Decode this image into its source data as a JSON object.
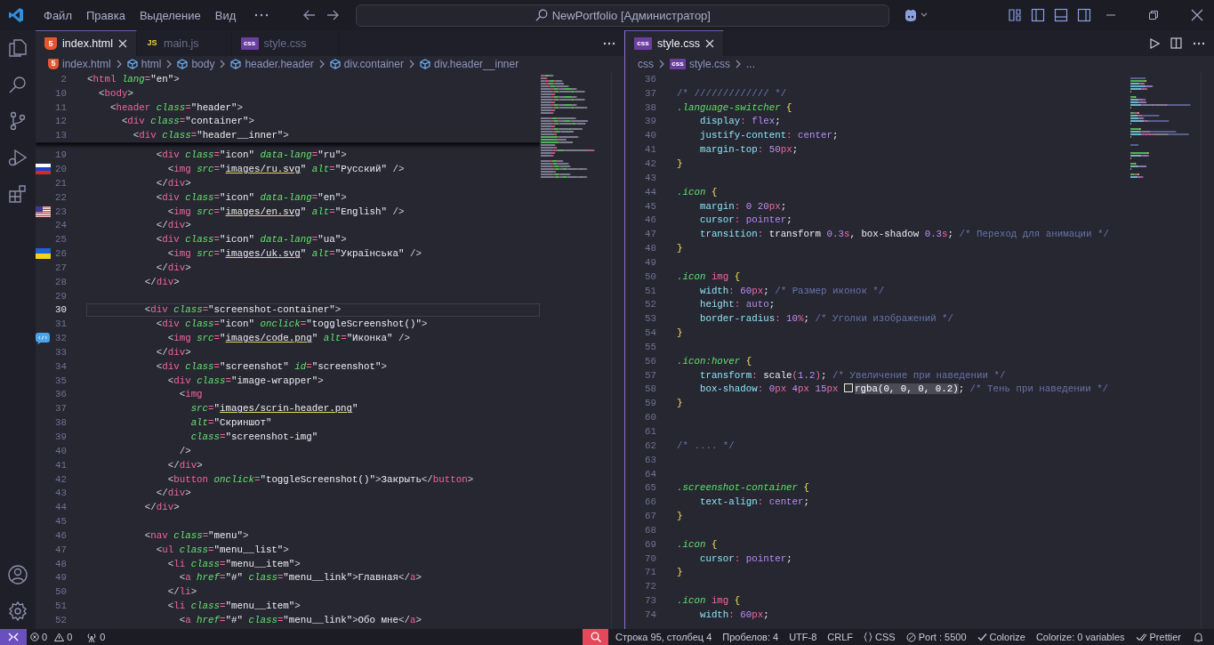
{
  "title_bar": {
    "menu": [
      "Файл",
      "Правка",
      "Выделение",
      "Вид"
    ],
    "search": {
      "text": "NewPortfolio [Администратор]"
    }
  },
  "editor_groups": [
    {
      "active": false,
      "tabs": [
        {
          "label": "index.html",
          "kind": "html",
          "badge": "5",
          "selected": true
        },
        {
          "label": "main.js",
          "kind": "js",
          "badge": "JS",
          "selected": false
        },
        {
          "label": "style.css",
          "kind": "css",
          "badge": "css",
          "selected": false
        }
      ],
      "breadcrumb": [
        {
          "label": "index.html",
          "kind": "html",
          "badge": "5"
        },
        {
          "label": "html",
          "kind": "element"
        },
        {
          "label": "body",
          "kind": "element"
        },
        {
          "label": "header.header",
          "kind": "element"
        },
        {
          "label": "div.container",
          "kind": "element"
        },
        {
          "label": "div.header__inner",
          "kind": "element"
        }
      ],
      "sticky_lines": [
        {
          "number": "2",
          "tokens": [
            {
              "kind": "p",
              "text": "<"
            },
            {
              "kind": "tag",
              "text": "html"
            },
            {
              "kind": "attr",
              "text": " lang"
            },
            {
              "kind": "op",
              "text": "="
            },
            {
              "kind": "str",
              "text": "\"en\""
            },
            {
              "kind": "p",
              "text": ">"
            }
          ]
        },
        {
          "number": "10",
          "tokens": [
            {
              "kind": "p",
              "text": "  <"
            },
            {
              "kind": "tag",
              "text": "body"
            },
            {
              "kind": "p",
              "text": ">"
            }
          ]
        },
        {
          "number": "11",
          "tokens": [
            {
              "kind": "p",
              "text": "    <"
            },
            {
              "kind": "tag",
              "text": "header"
            },
            {
              "kind": "attr",
              "text": " class"
            },
            {
              "kind": "op",
              "text": "="
            },
            {
              "kind": "str",
              "text": "\"header\""
            },
            {
              "kind": "p",
              "text": ">"
            }
          ]
        },
        {
          "number": "12",
          "tokens": [
            {
              "kind": "p",
              "text": "      <"
            },
            {
              "kind": "tag",
              "text": "div"
            },
            {
              "kind": "attr",
              "text": " class"
            },
            {
              "kind": "op",
              "text": "="
            },
            {
              "kind": "str",
              "text": "\"container\""
            },
            {
              "kind": "p",
              "text": ">"
            }
          ]
        },
        {
          "number": "13",
          "tokens": [
            {
              "kind": "p",
              "text": "        <"
            },
            {
              "kind": "tag",
              "text": "div"
            },
            {
              "kind": "attr",
              "text": " class"
            },
            {
              "kind": "op",
              "text": "="
            },
            {
              "kind": "str",
              "text": "\"header__inner\""
            },
            {
              "kind": "p",
              "text": ">"
            }
          ]
        }
      ],
      "lines": [
        {
          "number": "19",
          "current": false,
          "tokens": [
            {
              "kind": "p",
              "text": "            <"
            },
            {
              "kind": "tag",
              "text": "div"
            },
            {
              "kind": "attr",
              "text": " class"
            },
            {
              "kind": "op",
              "text": "="
            },
            {
              "kind": "str",
              "text": "\"icon\""
            },
            {
              "kind": "attr",
              "text": " data-lang"
            },
            {
              "kind": "op",
              "text": "="
            },
            {
              "kind": "str",
              "text": "\"ru\""
            },
            {
              "kind": "p",
              "text": ">"
            }
          ]
        },
        {
          "number": "20",
          "current": false,
          "gutter_icon": {
            "kind": "flag-ru"
          },
          "tokens": [
            {
              "kind": "p",
              "text": "              <"
            },
            {
              "kind": "tag",
              "text": "img"
            },
            {
              "kind": "attr",
              "text": " src"
            },
            {
              "kind": "op",
              "text": "="
            },
            {
              "kind": "str",
              "text": "\""
            },
            {
              "kind": "link",
              "text": "images/ru.svg"
            },
            {
              "kind": "str",
              "text": "\""
            },
            {
              "kind": "attr",
              "text": " alt"
            },
            {
              "kind": "op",
              "text": "="
            },
            {
              "kind": "str",
              "text": "\"Русский\""
            },
            {
              "kind": "p",
              "text": " />"
            }
          ]
        },
        {
          "number": "21",
          "current": false,
          "tokens": [
            {
              "kind": "p",
              "text": "            </"
            },
            {
              "kind": "tag",
              "text": "div"
            },
            {
              "kind": "p",
              "text": ">"
            }
          ]
        },
        {
          "number": "22",
          "current": false,
          "tokens": [
            {
              "kind": "p",
              "text": "            <"
            },
            {
              "kind": "tag",
              "text": "div"
            },
            {
              "kind": "attr",
              "text": " class"
            },
            {
              "kind": "op",
              "text": "="
            },
            {
              "kind": "str",
              "text": "\"icon\""
            },
            {
              "kind": "attr",
              "text": " data-lang"
            },
            {
              "kind": "op",
              "text": "="
            },
            {
              "kind": "str",
              "text": "\"en\""
            },
            {
              "kind": "p",
              "text": ">"
            }
          ]
        },
        {
          "number": "23",
          "current": false,
          "gutter_icon": {
            "kind": "flag-us"
          },
          "tokens": [
            {
              "kind": "p",
              "text": "              <"
            },
            {
              "kind": "tag",
              "text": "img"
            },
            {
              "kind": "attr",
              "text": " src"
            },
            {
              "kind": "op",
              "text": "="
            },
            {
              "kind": "str",
              "text": "\""
            },
            {
              "kind": "link",
              "text": "images/en.svg"
            },
            {
              "kind": "str",
              "text": "\""
            },
            {
              "kind": "attr",
              "text": " alt"
            },
            {
              "kind": "op",
              "text": "="
            },
            {
              "kind": "str",
              "text": "\"English\""
            },
            {
              "kind": "p",
              "text": " />"
            }
          ]
        },
        {
          "number": "24",
          "current": false,
          "tokens": [
            {
              "kind": "p",
              "text": "            </"
            },
            {
              "kind": "tag",
              "text": "div"
            },
            {
              "kind": "p",
              "text": ">"
            }
          ]
        },
        {
          "number": "25",
          "current": false,
          "tokens": [
            {
              "kind": "p",
              "text": "            <"
            },
            {
              "kind": "tag",
              "text": "div"
            },
            {
              "kind": "attr",
              "text": " class"
            },
            {
              "kind": "op",
              "text": "="
            },
            {
              "kind": "str",
              "text": "\"icon\""
            },
            {
              "kind": "attr",
              "text": " data-lang"
            },
            {
              "kind": "op",
              "text": "="
            },
            {
              "kind": "str",
              "text": "\"ua\""
            },
            {
              "kind": "p",
              "text": ">"
            }
          ]
        },
        {
          "number": "26",
          "current": false,
          "gutter_icon": {
            "kind": "flag-ua"
          },
          "tokens": [
            {
              "kind": "p",
              "text": "              <"
            },
            {
              "kind": "tag",
              "text": "img"
            },
            {
              "kind": "attr",
              "text": " src"
            },
            {
              "kind": "op",
              "text": "="
            },
            {
              "kind": "str",
              "text": "\""
            },
            {
              "kind": "link",
              "text": "images/uk.svg"
            },
            {
              "kind": "str",
              "text": "\""
            },
            {
              "kind": "attr",
              "text": " alt"
            },
            {
              "kind": "op",
              "text": "="
            },
            {
              "kind": "str",
              "text": "\"Українська\""
            },
            {
              "kind": "p",
              "text": " />"
            }
          ]
        },
        {
          "number": "27",
          "current": false,
          "tokens": [
            {
              "kind": "p",
              "text": "            </"
            },
            {
              "kind": "tag",
              "text": "div"
            },
            {
              "kind": "p",
              "text": ">"
            }
          ]
        },
        {
          "number": "28",
          "current": false,
          "tokens": [
            {
              "kind": "p",
              "text": "          </"
            },
            {
              "kind": "tag",
              "text": "div"
            },
            {
              "kind": "p",
              "text": ">"
            }
          ]
        },
        {
          "number": "29",
          "current": false
        },
        {
          "number": "30",
          "current": true,
          "tokens": [
            {
              "kind": "p",
              "text": "          <"
            },
            {
              "kind": "tag",
              "text": "div"
            },
            {
              "kind": "attr",
              "text": " class"
            },
            {
              "kind": "op",
              "text": "="
            },
            {
              "kind": "str",
              "text": "\"screenshot-container\""
            },
            {
              "kind": "p",
              "text": ">"
            }
          ]
        },
        {
          "number": "31",
          "current": false,
          "tokens": [
            {
              "kind": "p",
              "text": "            <"
            },
            {
              "kind": "tag",
              "text": "div"
            },
            {
              "kind": "attr",
              "text": " class"
            },
            {
              "kind": "op",
              "text": "="
            },
            {
              "kind": "str",
              "text": "\"icon\""
            },
            {
              "kind": "attr",
              "text": " onclick"
            },
            {
              "kind": "op",
              "text": "="
            },
            {
              "kind": "str",
              "text": "\"toggleScreenshot()\""
            },
            {
              "kind": "p",
              "text": ">"
            }
          ]
        },
        {
          "number": "32",
          "current": false,
          "gutter_icon": {
            "kind": "code-image"
          },
          "tokens": [
            {
              "kind": "p",
              "text": "              <"
            },
            {
              "kind": "tag",
              "text": "img"
            },
            {
              "kind": "attr",
              "text": " src"
            },
            {
              "kind": "op",
              "text": "="
            },
            {
              "kind": "str",
              "text": "\""
            },
            {
              "kind": "link",
              "text": "images/code.png"
            },
            {
              "kind": "str",
              "text": "\""
            },
            {
              "kind": "attr",
              "text": " alt"
            },
            {
              "kind": "op",
              "text": "="
            },
            {
              "kind": "str",
              "text": "\"Иконка\""
            },
            {
              "kind": "p",
              "text": " />"
            }
          ]
        },
        {
          "number": "33",
          "current": false,
          "tokens": [
            {
              "kind": "p",
              "text": "            </"
            },
            {
              "kind": "tag",
              "text": "div"
            },
            {
              "kind": "p",
              "text": ">"
            }
          ]
        },
        {
          "number": "34",
          "current": false,
          "tokens": [
            {
              "kind": "p",
              "text": "            <"
            },
            {
              "kind": "tag",
              "text": "div"
            },
            {
              "kind": "attr",
              "text": " class"
            },
            {
              "kind": "op",
              "text": "="
            },
            {
              "kind": "str",
              "text": "\"screenshot\""
            },
            {
              "kind": "attr",
              "text": " id"
            },
            {
              "kind": "op",
              "text": "="
            },
            {
              "kind": "str",
              "text": "\"screenshot\""
            },
            {
              "kind": "p",
              "text": ">"
            }
          ]
        },
        {
          "number": "35",
          "current": false,
          "tokens": [
            {
              "kind": "p",
              "text": "              <"
            },
            {
              "kind": "tag",
              "text": "div"
            },
            {
              "kind": "attr",
              "text": " class"
            },
            {
              "kind": "op",
              "text": "="
            },
            {
              "kind": "str",
              "text": "\"image-wrapper\""
            },
            {
              "kind": "p",
              "text": ">"
            }
          ]
        },
        {
          "number": "36",
          "current": false,
          "tokens": [
            {
              "kind": "p",
              "text": "                <"
            },
            {
              "kind": "tag",
              "text": "img"
            }
          ]
        },
        {
          "number": "37",
          "current": false,
          "tokens": [
            {
              "kind": "attr",
              "text": "                  src"
            },
            {
              "kind": "op",
              "text": "="
            },
            {
              "kind": "str",
              "text": "\""
            },
            {
              "kind": "link",
              "text": "images/scrin-header.png"
            },
            {
              "kind": "str",
              "text": "\""
            }
          ]
        },
        {
          "number": "38",
          "current": false,
          "tokens": [
            {
              "kind": "attr",
              "text": "                  alt"
            },
            {
              "kind": "op",
              "text": "="
            },
            {
              "kind": "str",
              "text": "\"Скриншот\""
            }
          ]
        },
        {
          "number": "39",
          "current": false,
          "tokens": [
            {
              "kind": "attr",
              "text": "                  class"
            },
            {
              "kind": "op",
              "text": "="
            },
            {
              "kind": "str",
              "text": "\"screenshot-img\""
            }
          ]
        },
        {
          "number": "40",
          "current": false,
          "tokens": [
            {
              "kind": "p",
              "text": "                />"
            }
          ]
        },
        {
          "number": "41",
          "current": false,
          "tokens": [
            {
              "kind": "p",
              "text": "              </"
            },
            {
              "kind": "tag",
              "text": "div"
            },
            {
              "kind": "p",
              "text": ">"
            }
          ]
        },
        {
          "number": "42",
          "current": false,
          "tokens": [
            {
              "kind": "p",
              "text": "              <"
            },
            {
              "kind": "tag",
              "text": "button"
            },
            {
              "kind": "attr",
              "text": " onclick"
            },
            {
              "kind": "op",
              "text": "="
            },
            {
              "kind": "str",
              "text": "\"toggleScreenshot()\""
            },
            {
              "kind": "p",
              "text": ">"
            },
            {
              "kind": "t",
              "text": "Закрыть"
            },
            {
              "kind": "p",
              "text": "</"
            },
            {
              "kind": "tag",
              "text": "button"
            },
            {
              "kind": "p",
              "text": ">"
            }
          ]
        },
        {
          "number": "43",
          "current": false,
          "tokens": [
            {
              "kind": "p",
              "text": "            </"
            },
            {
              "kind": "tag",
              "text": "div"
            },
            {
              "kind": "p",
              "text": ">"
            }
          ]
        },
        {
          "number": "44",
          "current": false,
          "tokens": [
            {
              "kind": "p",
              "text": "          </"
            },
            {
              "kind": "tag",
              "text": "div"
            },
            {
              "kind": "p",
              "text": ">"
            }
          ]
        },
        {
          "number": "45",
          "current": false
        },
        {
          "number": "46",
          "current": false,
          "tokens": [
            {
              "kind": "p",
              "text": "          <"
            },
            {
              "kind": "tag",
              "text": "nav"
            },
            {
              "kind": "attr",
              "text": " class"
            },
            {
              "kind": "op",
              "text": "="
            },
            {
              "kind": "str",
              "text": "\"menu\""
            },
            {
              "kind": "p",
              "text": ">"
            }
          ]
        },
        {
          "number": "47",
          "current": false,
          "tokens": [
            {
              "kind": "p",
              "text": "            <"
            },
            {
              "kind": "tag",
              "text": "ul"
            },
            {
              "kind": "attr",
              "text": " class"
            },
            {
              "kind": "op",
              "text": "="
            },
            {
              "kind": "str",
              "text": "\"menu__list\""
            },
            {
              "kind": "p",
              "text": ">"
            }
          ]
        },
        {
          "number": "48",
          "current": false,
          "tokens": [
            {
              "kind": "p",
              "text": "              <"
            },
            {
              "kind": "tag",
              "text": "li"
            },
            {
              "kind": "attr",
              "text": " class"
            },
            {
              "kind": "op",
              "text": "="
            },
            {
              "kind": "str",
              "text": "\"menu__item\""
            },
            {
              "kind": "p",
              "text": ">"
            }
          ]
        },
        {
          "number": "49",
          "current": false,
          "tokens": [
            {
              "kind": "p",
              "text": "                <"
            },
            {
              "kind": "tag",
              "text": "a"
            },
            {
              "kind": "attr",
              "text": " href"
            },
            {
              "kind": "op",
              "text": "="
            },
            {
              "kind": "str",
              "text": "\"#\""
            },
            {
              "kind": "attr",
              "text": " class"
            },
            {
              "kind": "op",
              "text": "="
            },
            {
              "kind": "str",
              "text": "\"menu__link\""
            },
            {
              "kind": "p",
              "text": ">"
            },
            {
              "kind": "t",
              "text": "Главная"
            },
            {
              "kind": "p",
              "text": "</"
            },
            {
              "kind": "tag",
              "text": "a"
            },
            {
              "kind": "p",
              "text": ">"
            }
          ]
        },
        {
          "number": "50",
          "current": false,
          "tokens": [
            {
              "kind": "p",
              "text": "              </"
            },
            {
              "kind": "tag",
              "text": "li"
            },
            {
              "kind": "p",
              "text": ">"
            }
          ]
        },
        {
          "number": "51",
          "current": false,
          "tokens": [
            {
              "kind": "p",
              "text": "              <"
            },
            {
              "kind": "tag",
              "text": "li"
            },
            {
              "kind": "attr",
              "text": " class"
            },
            {
              "kind": "op",
              "text": "="
            },
            {
              "kind": "str",
              "text": "\"menu__item\""
            },
            {
              "kind": "p",
              "text": ">"
            }
          ]
        },
        {
          "number": "52",
          "current": false,
          "tokens": [
            {
              "kind": "p",
              "text": "                <"
            },
            {
              "kind": "tag",
              "text": "a"
            },
            {
              "kind": "attr",
              "text": " href"
            },
            {
              "kind": "op",
              "text": "="
            },
            {
              "kind": "str",
              "text": "\"#\""
            },
            {
              "kind": "attr",
              "text": " class"
            },
            {
              "kind": "op",
              "text": "="
            },
            {
              "kind": "str",
              "text": "\"menu__link\""
            },
            {
              "kind": "p",
              "text": ">"
            },
            {
              "kind": "t",
              "text": "Обо мне"
            },
            {
              "kind": "p",
              "text": "</"
            },
            {
              "kind": "tag",
              "text": "a"
            },
            {
              "kind": "p",
              "text": ">"
            }
          ]
        }
      ]
    },
    {
      "active": true,
      "tabs": [
        {
          "label": "style.css",
          "kind": "css",
          "badge": "css",
          "selected": true
        }
      ],
      "breadcrumb": [
        {
          "label": "css",
          "kind": "folder"
        },
        {
          "label": "style.css",
          "kind": "css",
          "badge": "css"
        },
        {
          "label": "...",
          "kind": "more"
        }
      ],
      "lines": [
        {
          "number": "36"
        },
        {
          "number": "37",
          "tokens": [
            {
              "kind": "cm",
              "text": "/* ///////////// */"
            }
          ]
        },
        {
          "number": "38",
          "tokens": [
            {
              "kind": "sel",
              "text": ".language-switcher"
            },
            {
              "kind": "br",
              "text": " {"
            }
          ]
        },
        {
          "number": "39",
          "tokens": [
            {
              "kind": "prop",
              "text": "    display"
            },
            {
              "kind": "op",
              "text": ":"
            },
            {
              "kind": "val",
              "text": " flex"
            },
            {
              "kind": "t",
              "text": ";"
            }
          ]
        },
        {
          "number": "40",
          "tokens": [
            {
              "kind": "prop",
              "text": "    justify-content"
            },
            {
              "kind": "op",
              "text": ":"
            },
            {
              "kind": "val",
              "text": " center"
            },
            {
              "kind": "t",
              "text": ";"
            }
          ]
        },
        {
          "number": "41",
          "tokens": [
            {
              "kind": "prop",
              "text": "    margin-top"
            },
            {
              "kind": "op",
              "text": ":"
            },
            {
              "kind": "num",
              "text": " 50"
            },
            {
              "kind": "op",
              "text": "px"
            },
            {
              "kind": "t",
              "text": ";"
            }
          ]
        },
        {
          "number": "42",
          "tokens": [
            {
              "kind": "br",
              "text": "}"
            }
          ]
        },
        {
          "number": "43"
        },
        {
          "number": "44",
          "tokens": [
            {
              "kind": "sel",
              "text": ".icon"
            },
            {
              "kind": "br",
              "text": " {"
            }
          ]
        },
        {
          "number": "45",
          "tokens": [
            {
              "kind": "prop",
              "text": "    margin"
            },
            {
              "kind": "op",
              "text": ":"
            },
            {
              "kind": "num",
              "text": " 0 20"
            },
            {
              "kind": "op",
              "text": "px"
            },
            {
              "kind": "t",
              "text": ";"
            }
          ]
        },
        {
          "number": "46",
          "tokens": [
            {
              "kind": "prop",
              "text": "    cursor"
            },
            {
              "kind": "op",
              "text": ":"
            },
            {
              "kind": "val",
              "text": " pointer"
            },
            {
              "kind": "t",
              "text": ";"
            }
          ]
        },
        {
          "number": "47",
          "tokens": [
            {
              "kind": "prop",
              "text": "    transition"
            },
            {
              "kind": "op",
              "text": ":"
            },
            {
              "kind": "t",
              "text": " transform "
            },
            {
              "kind": "num",
              "text": "0.3"
            },
            {
              "kind": "op",
              "text": "s"
            },
            {
              "kind": "t",
              "text": ", box-shadow "
            },
            {
              "kind": "num",
              "text": "0.3"
            },
            {
              "kind": "op",
              "text": "s"
            },
            {
              "kind": "t",
              "text": ";"
            },
            {
              "kind": "cm",
              "text": " /* Переход для анимации */"
            }
          ]
        },
        {
          "number": "48",
          "tokens": [
            {
              "kind": "br",
              "text": "}"
            }
          ]
        },
        {
          "number": "49"
        },
        {
          "number": "50",
          "tokens": [
            {
              "kind": "sel",
              "text": ".icon"
            },
            {
              "kind": "tag",
              "text": " img"
            },
            {
              "kind": "br",
              "text": " {"
            }
          ]
        },
        {
          "number": "51",
          "tokens": [
            {
              "kind": "prop",
              "text": "    width"
            },
            {
              "kind": "op",
              "text": ":"
            },
            {
              "kind": "num",
              "text": " 60"
            },
            {
              "kind": "op",
              "text": "px"
            },
            {
              "kind": "t",
              "text": ";"
            },
            {
              "kind": "cm",
              "text": " /* Размер иконок */"
            }
          ]
        },
        {
          "number": "52",
          "tokens": [
            {
              "kind": "prop",
              "text": "    height"
            },
            {
              "kind": "op",
              "text": ":"
            },
            {
              "kind": "val",
              "text": " auto"
            },
            {
              "kind": "t",
              "text": ";"
            }
          ]
        },
        {
          "number": "53",
          "tokens": [
            {
              "kind": "prop",
              "text": "    border-radius"
            },
            {
              "kind": "op",
              "text": ":"
            },
            {
              "kind": "num",
              "text": " 10"
            },
            {
              "kind": "op",
              "text": "%"
            },
            {
              "kind": "t",
              "text": ";"
            },
            {
              "kind": "cm",
              "text": " /* Уголки изображений */"
            }
          ]
        },
        {
          "number": "54",
          "tokens": [
            {
              "kind": "br",
              "text": "}"
            }
          ]
        },
        {
          "number": "55"
        },
        {
          "number": "56",
          "tokens": [
            {
              "kind": "sel",
              "text": ".icon:hover"
            },
            {
              "kind": "br",
              "text": " {"
            }
          ]
        },
        {
          "number": "57",
          "tokens": [
            {
              "kind": "prop",
              "text": "    transform"
            },
            {
              "kind": "op",
              "text": ":"
            },
            {
              "kind": "t",
              "text": " scale"
            },
            {
              "kind": "op",
              "text": "("
            },
            {
              "kind": "num",
              "text": "1.2"
            },
            {
              "kind": "op",
              "text": ")"
            },
            {
              "kind": "t",
              "text": ";"
            },
            {
              "kind": "cm",
              "text": " /* Увеличение при наведении */"
            }
          ]
        },
        {
          "number": "58",
          "tokens": [
            {
              "kind": "prop",
              "text": "    box-shadow"
            },
            {
              "kind": "op",
              "text": ":"
            },
            {
              "kind": "num",
              "text": " 0"
            },
            {
              "kind": "op",
              "text": "px"
            },
            {
              "kind": "num",
              "text": " 4"
            },
            {
              "kind": "op",
              "text": "px"
            },
            {
              "kind": "num",
              "text": " 15"
            },
            {
              "kind": "op",
              "text": "px "
            },
            {
              "kind": "colorfn",
              "text": "rgba(0, 0, 0, 0.2)"
            },
            {
              "kind": "t",
              "text": ";"
            },
            {
              "kind": "cm",
              "text": " /* Тень при наведении */"
            }
          ]
        },
        {
          "number": "59",
          "tokens": [
            {
              "kind": "br",
              "text": "}"
            }
          ]
        },
        {
          "number": "60"
        },
        {
          "number": "61"
        },
        {
          "number": "62",
          "tokens": [
            {
              "kind": "cm",
              "text": "/* .... */"
            }
          ]
        },
        {
          "number": "63"
        },
        {
          "number": "64"
        },
        {
          "number": "65",
          "tokens": [
            {
              "kind": "sel",
              "text": ".screenshot-container"
            },
            {
              "kind": "br",
              "text": " {"
            }
          ]
        },
        {
          "number": "66",
          "tokens": [
            {
              "kind": "prop",
              "text": "    text-align"
            },
            {
              "kind": "op",
              "text": ":"
            },
            {
              "kind": "val",
              "text": " center"
            },
            {
              "kind": "t",
              "text": ";"
            }
          ]
        },
        {
          "number": "67",
          "tokens": [
            {
              "kind": "br",
              "text": "}"
            }
          ]
        },
        {
          "number": "68"
        },
        {
          "number": "69",
          "tokens": [
            {
              "kind": "sel",
              "text": ".icon"
            },
            {
              "kind": "br",
              "text": " {"
            }
          ]
        },
        {
          "number": "70",
          "tokens": [
            {
              "kind": "prop",
              "text": "    cursor"
            },
            {
              "kind": "op",
              "text": ":"
            },
            {
              "kind": "val",
              "text": " pointer"
            },
            {
              "kind": "t",
              "text": ";"
            }
          ]
        },
        {
          "number": "71",
          "tokens": [
            {
              "kind": "br",
              "text": "}"
            }
          ]
        },
        {
          "number": "72"
        },
        {
          "number": "73",
          "tokens": [
            {
              "kind": "sel",
              "text": ".icon"
            },
            {
              "kind": "tag",
              "text": " img"
            },
            {
              "kind": "br",
              "text": " {"
            }
          ]
        },
        {
          "number": "74",
          "tokens": [
            {
              "kind": "prop",
              "text": "    width"
            },
            {
              "kind": "op",
              "text": ":"
            },
            {
              "kind": "num",
              "text": " 60"
            },
            {
              "kind": "op",
              "text": "px"
            },
            {
              "kind": "t",
              "text": ";"
            }
          ]
        }
      ]
    }
  ],
  "status_bar": {
    "left": [
      {
        "kind": "errors",
        "text": "0"
      },
      {
        "kind": "warnings",
        "text": "0"
      },
      {
        "kind": "ports",
        "text": "0"
      }
    ],
    "right": [
      {
        "kind": "plain",
        "text": "Строка 95, столбец 4"
      },
      {
        "kind": "plain",
        "text": "Пробелов: 4"
      },
      {
        "kind": "plain",
        "text": "UTF-8"
      },
      {
        "kind": "plain",
        "text": "CRLF"
      },
      {
        "kind": "language",
        "text": "CSS"
      },
      {
        "kind": "port",
        "text": "Port : 5500"
      },
      {
        "kind": "check",
        "text": "Colorize"
      },
      {
        "kind": "plain",
        "text": "Colorize: 0 variables"
      },
      {
        "kind": "double-check",
        "text": "Prettier"
      }
    ]
  }
}
